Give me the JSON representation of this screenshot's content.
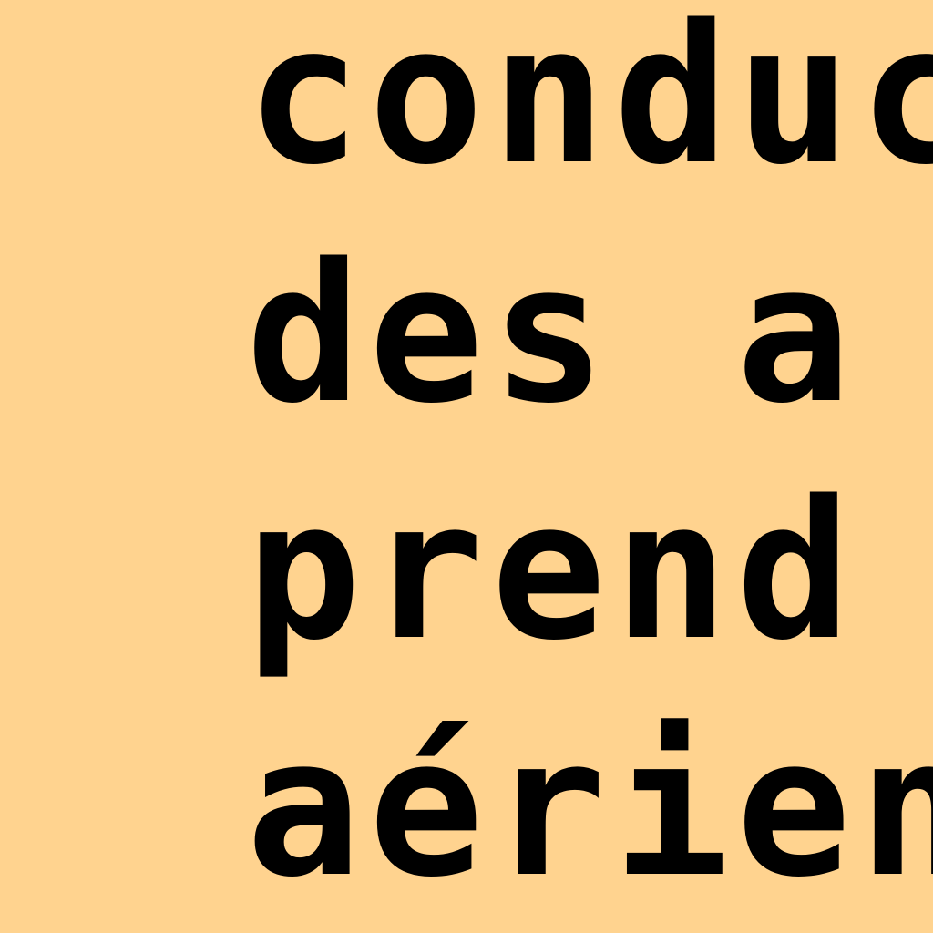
{
  "colors": {
    "background": "#FFD38F",
    "text": "#000000"
  },
  "lines": [
    "conduc",
    "des a",
    "prend",
    "aériens"
  ]
}
